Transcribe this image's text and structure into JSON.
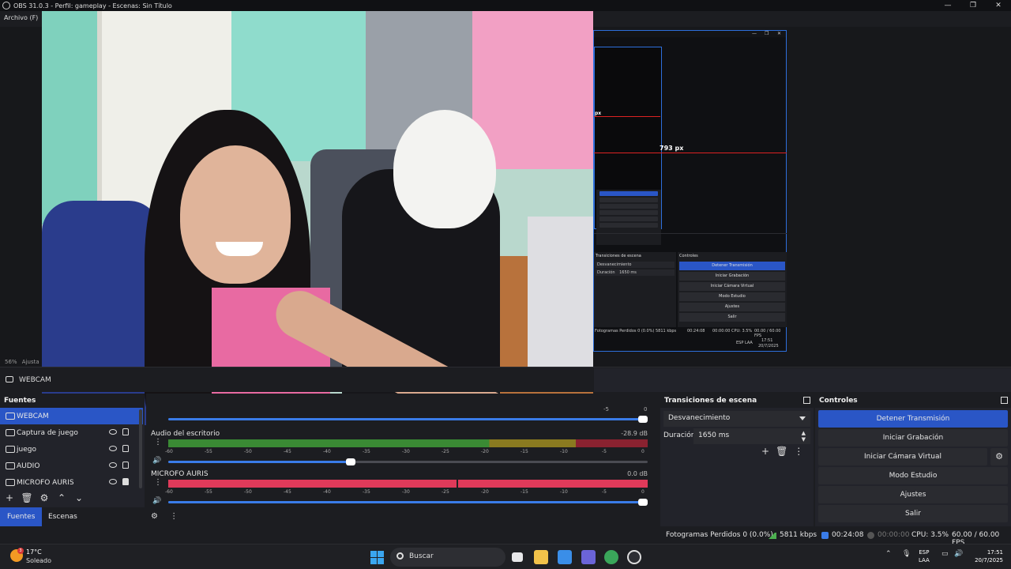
{
  "window": {
    "title": "OBS 31.0.3 - Perfil: gameplay - Escenas: Sin Título",
    "minimize": "—",
    "maximize": "❐",
    "close": "✕"
  },
  "menu": {
    "file": "Archivo (F)"
  },
  "preview": {
    "zoom": "56%",
    "zoom_mode": "Ajusta",
    "nested": {
      "px_small": "px",
      "px_big": "793 px",
      "controls_title": "Controles",
      "transitions_title": "Transiciones de escena",
      "transition_value": "Desvanecimiento",
      "duration_label": "Duración",
      "duration_value": "1650 ms",
      "btn_stop": "Detener Transmisión",
      "btn_rec": "Iniciar Grabación",
      "btn_vcam": "Iniciar Cámara Virtual",
      "btn_studio": "Modo Estudio",
      "btn_settings": "Ajustes",
      "btn_exit": "Salir",
      "status_dropped": "Fotogramas Perdidos 0 (0.0%)",
      "status_kbps": "5811 kbps",
      "status_time": "00:24:08",
      "status_rec": "00:00:00",
      "status_cpu": "CPU: 3.5%",
      "status_fps": "00.00 / 60.00 FPS",
      "task_lang": "ESP LAA",
      "task_time": "17:51",
      "task_date": "20/7/2025"
    }
  },
  "source_bar": {
    "label": "WEBCAM"
  },
  "sources": {
    "title": "Fuentes",
    "items": [
      {
        "label": "WEBCAM",
        "icon": "camera-icon",
        "selected": true
      },
      {
        "label": "Captura de juego",
        "icon": "gamepad-icon",
        "selected": false
      },
      {
        "label": "juego",
        "icon": "window-icon",
        "selected": false
      },
      {
        "label": "AUDIO",
        "icon": "speaker-icon",
        "selected": false
      },
      {
        "label": "MICROFO AURIS",
        "icon": "microphone-icon",
        "selected": false
      }
    ],
    "btn_add": "+",
    "btn_remove": "🗑",
    "btn_props": "⚙",
    "btn_up": "⌃",
    "btn_down": "⌄"
  },
  "tabs": {
    "sources": "Fuentes",
    "scenes": "Escenas"
  },
  "mixer": {
    "top_db_left": "-5",
    "top_db_right": "0",
    "tracks": [
      {
        "name": "Audio del escritorio",
        "db": "-28.9 dB",
        "volume": 0.38,
        "meter": "green"
      },
      {
        "name": "MICROFO AURIS",
        "db": "0.0 dB",
        "volume": 1.0,
        "meter": "red"
      }
    ],
    "ticks": [
      "-60",
      "-55",
      "-50",
      "-45",
      "-40",
      "-35",
      "-30",
      "-25",
      "-20",
      "-15",
      "-10",
      "-5",
      "0"
    ]
  },
  "transitions": {
    "title": "Transiciones de escena",
    "type": "Desvanecimiento",
    "duration_label": "Duración",
    "duration_value": "1650 ms",
    "btn_add": "+",
    "btn_remove": "🗑",
    "btn_more": "⋮"
  },
  "controls": {
    "title": "Controles",
    "stop_stream": "Detener Transmisión",
    "start_recording": "Iniciar Grabación",
    "start_virtual_cam": "Iniciar Cámara Virtual",
    "studio_mode": "Modo Estudio",
    "settings": "Ajustes",
    "exit": "Salir"
  },
  "status": {
    "dropped": "Fotogramas Perdidos 0 (0.0%)",
    "bitrate": "5811 kbps",
    "stream_time": "00:24:08",
    "rec_time": "00:00:00",
    "cpu": "CPU: 3.5%",
    "fps": "60.00 / 60.00 FPS"
  },
  "taskbar": {
    "weather_badge": "3",
    "temp": "17°C",
    "condition": "Soleado",
    "search": "Buscar",
    "lang_top": "ESP",
    "lang_bottom": "LAA",
    "time": "17:51",
    "date": "20/7/2025"
  }
}
